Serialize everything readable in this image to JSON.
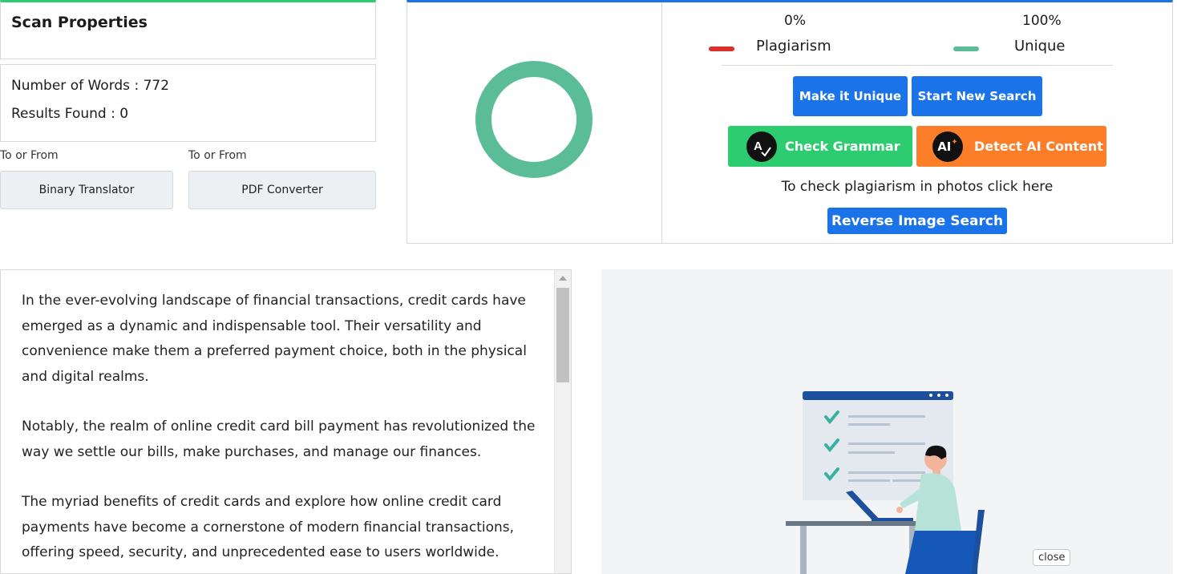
{
  "scan": {
    "title": "Scan Properties",
    "words_line": "Number of Words : 772",
    "results_line": "Results Found : 0"
  },
  "tools": [
    {
      "label": "To or From",
      "button": "Binary Translator"
    },
    {
      "label": "To or From",
      "button": "PDF Converter"
    }
  ],
  "result": {
    "plagiarism_percent": "0%",
    "plagiarism_label": "Plagiarism",
    "unique_percent": "100%",
    "unique_label": "Unique",
    "plagiarism_fraction": 0,
    "unique_fraction": 1,
    "colors": {
      "plagiarism": "#d9302c",
      "unique": "#5bbd98",
      "primary": "#1a73e8",
      "grammar": "#2ecc71",
      "ai": "#fd7e29"
    }
  },
  "actions": {
    "make_unique": "Make it Unique",
    "start_new_search": "Start New Search",
    "check_grammar": "Check Grammar",
    "detect_ai": "Detect AI Content",
    "photo_text": "To check plagiarism in photos click here",
    "reverse_image": "Reverse Image Search",
    "grammar_icon_text": "A",
    "ai_icon_text": "AI"
  },
  "content": {
    "paragraphs": [
      "In the ever-evolving landscape of financial transactions, credit cards have emerged as a dynamic and indispensable tool. Their versatility and convenience make them a preferred payment choice, both in the physical and digital realms.",
      "Notably, the realm of online credit card bill payment has revolutionized the way we settle our bills, make purchases, and manage our finances.",
      "The myriad benefits of credit cards and explore how online credit card payments have become a cornerstone of modern financial transactions, offering speed, security, and unprecedented ease to users worldwide."
    ]
  },
  "illustration": {
    "close_label": "close"
  }
}
